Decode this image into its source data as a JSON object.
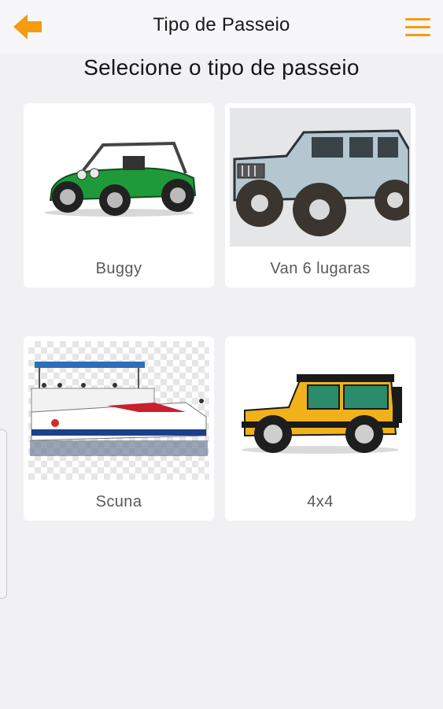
{
  "header": {
    "title": "Tipo de Passeio",
    "back_icon": "arrow-left-icon",
    "menu_icon": "hamburger-menu-icon",
    "accent_color": "#f59a12"
  },
  "heading": "Selecione o tipo de passeio",
  "tours": [
    {
      "label": "Buggy",
      "image": "green-buggy-image"
    },
    {
      "label": "Van 6 lugaras",
      "image": "blue-jeep-image"
    },
    {
      "label": "Scuna",
      "image": "schooner-boat-image"
    },
    {
      "label": "4x4",
      "image": "yellow-jeep-image"
    }
  ]
}
